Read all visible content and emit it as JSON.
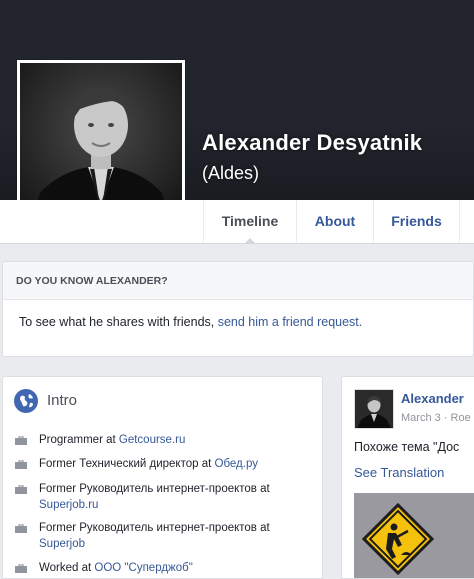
{
  "profile": {
    "name": "Alexander Desyatnik",
    "alternate_name": "(Aldes)",
    "photo_alt": "profile-photo"
  },
  "tabs": [
    {
      "label": "Timeline",
      "active": true
    },
    {
      "label": "About",
      "active": false
    },
    {
      "label": "Friends",
      "active": false
    }
  ],
  "know_card": {
    "title": "DO YOU KNOW ALEXANDER?",
    "body_prefix": "To see what he shares with friends, ",
    "link_text": "send him a friend request."
  },
  "intro": {
    "title": "Intro",
    "work": [
      {
        "prefix": "Programmer at ",
        "link": "Getcourse.ru"
      },
      {
        "prefix": "Former Технический директор at ",
        "link": "Обед.ру"
      },
      {
        "prefix": "Former Руководитель интернет-проектов at ",
        "link": "Superjob.ru"
      },
      {
        "prefix": "Former Руководитель интернет-проектов at ",
        "link": "Superjob"
      },
      {
        "prefix": "Worked at ",
        "link": "ООО \"Суперджоб\""
      }
    ]
  },
  "post": {
    "author": "Alexander",
    "date": "March 3 · Roe",
    "text": "Похоже тема \"Дос",
    "see_translation": "See Translation",
    "image_icon": "construction-sign-icon"
  },
  "colors": {
    "cover": "#22252d",
    "link": "#365899",
    "text": "#1d2129",
    "background": "#e9ebee",
    "sign": "#f4c20d"
  }
}
